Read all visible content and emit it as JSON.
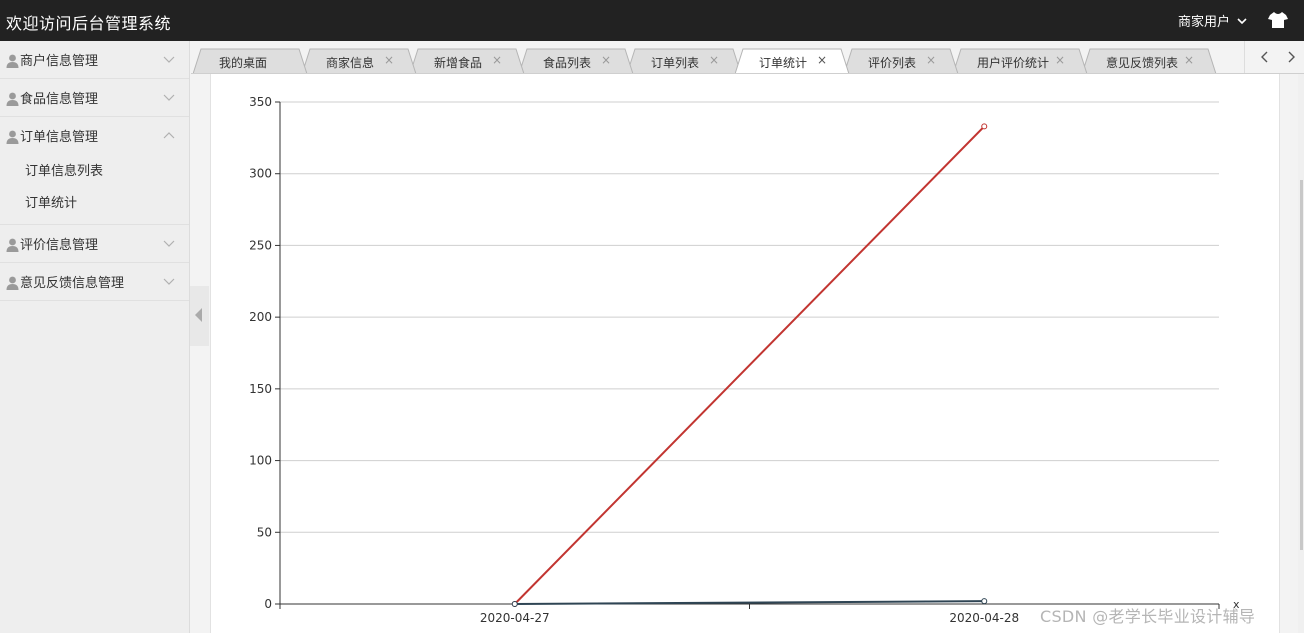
{
  "app": {
    "title": "欢迎访问后台管理系统"
  },
  "header": {
    "user_label": "商家用户"
  },
  "sidebar": {
    "groups": [
      {
        "label": "商户信息管理",
        "expanded": false
      },
      {
        "label": "食品信息管理",
        "expanded": false
      },
      {
        "label": "订单信息管理",
        "expanded": true,
        "items": [
          "订单信息列表",
          "订单统计"
        ]
      },
      {
        "label": "评价信息管理",
        "expanded": false
      },
      {
        "label": "意见反馈信息管理",
        "expanded": false
      }
    ]
  },
  "tabs": [
    {
      "label": "我的桌面",
      "closable": false,
      "active": false
    },
    {
      "label": "商家信息",
      "closable": true,
      "active": false
    },
    {
      "label": "新增食品",
      "closable": true,
      "active": false
    },
    {
      "label": "食品列表",
      "closable": true,
      "active": false
    },
    {
      "label": "订单列表",
      "closable": true,
      "active": false
    },
    {
      "label": "订单统计",
      "closable": true,
      "active": true
    },
    {
      "label": "评价列表",
      "closable": true,
      "active": false
    },
    {
      "label": "用户评价统计",
      "closable": true,
      "active": false
    },
    {
      "label": "意见反馈列表",
      "closable": true,
      "active": false
    }
  ],
  "tab_close_glyph": "×",
  "chart_data": {
    "type": "line",
    "x": [
      "2020-04-27",
      "2020-04-28"
    ],
    "series": [
      {
        "values": [
          0,
          333
        ],
        "color": "#c23531"
      },
      {
        "values": [
          0,
          2
        ],
        "color": "#2f4554"
      }
    ],
    "ylim": [
      0,
      350
    ],
    "yticks": [
      0,
      50,
      100,
      150,
      200,
      250,
      300,
      350
    ],
    "xlabel": "x",
    "grid": true
  },
  "watermark": "CSDN @老学长毕业设计辅导"
}
